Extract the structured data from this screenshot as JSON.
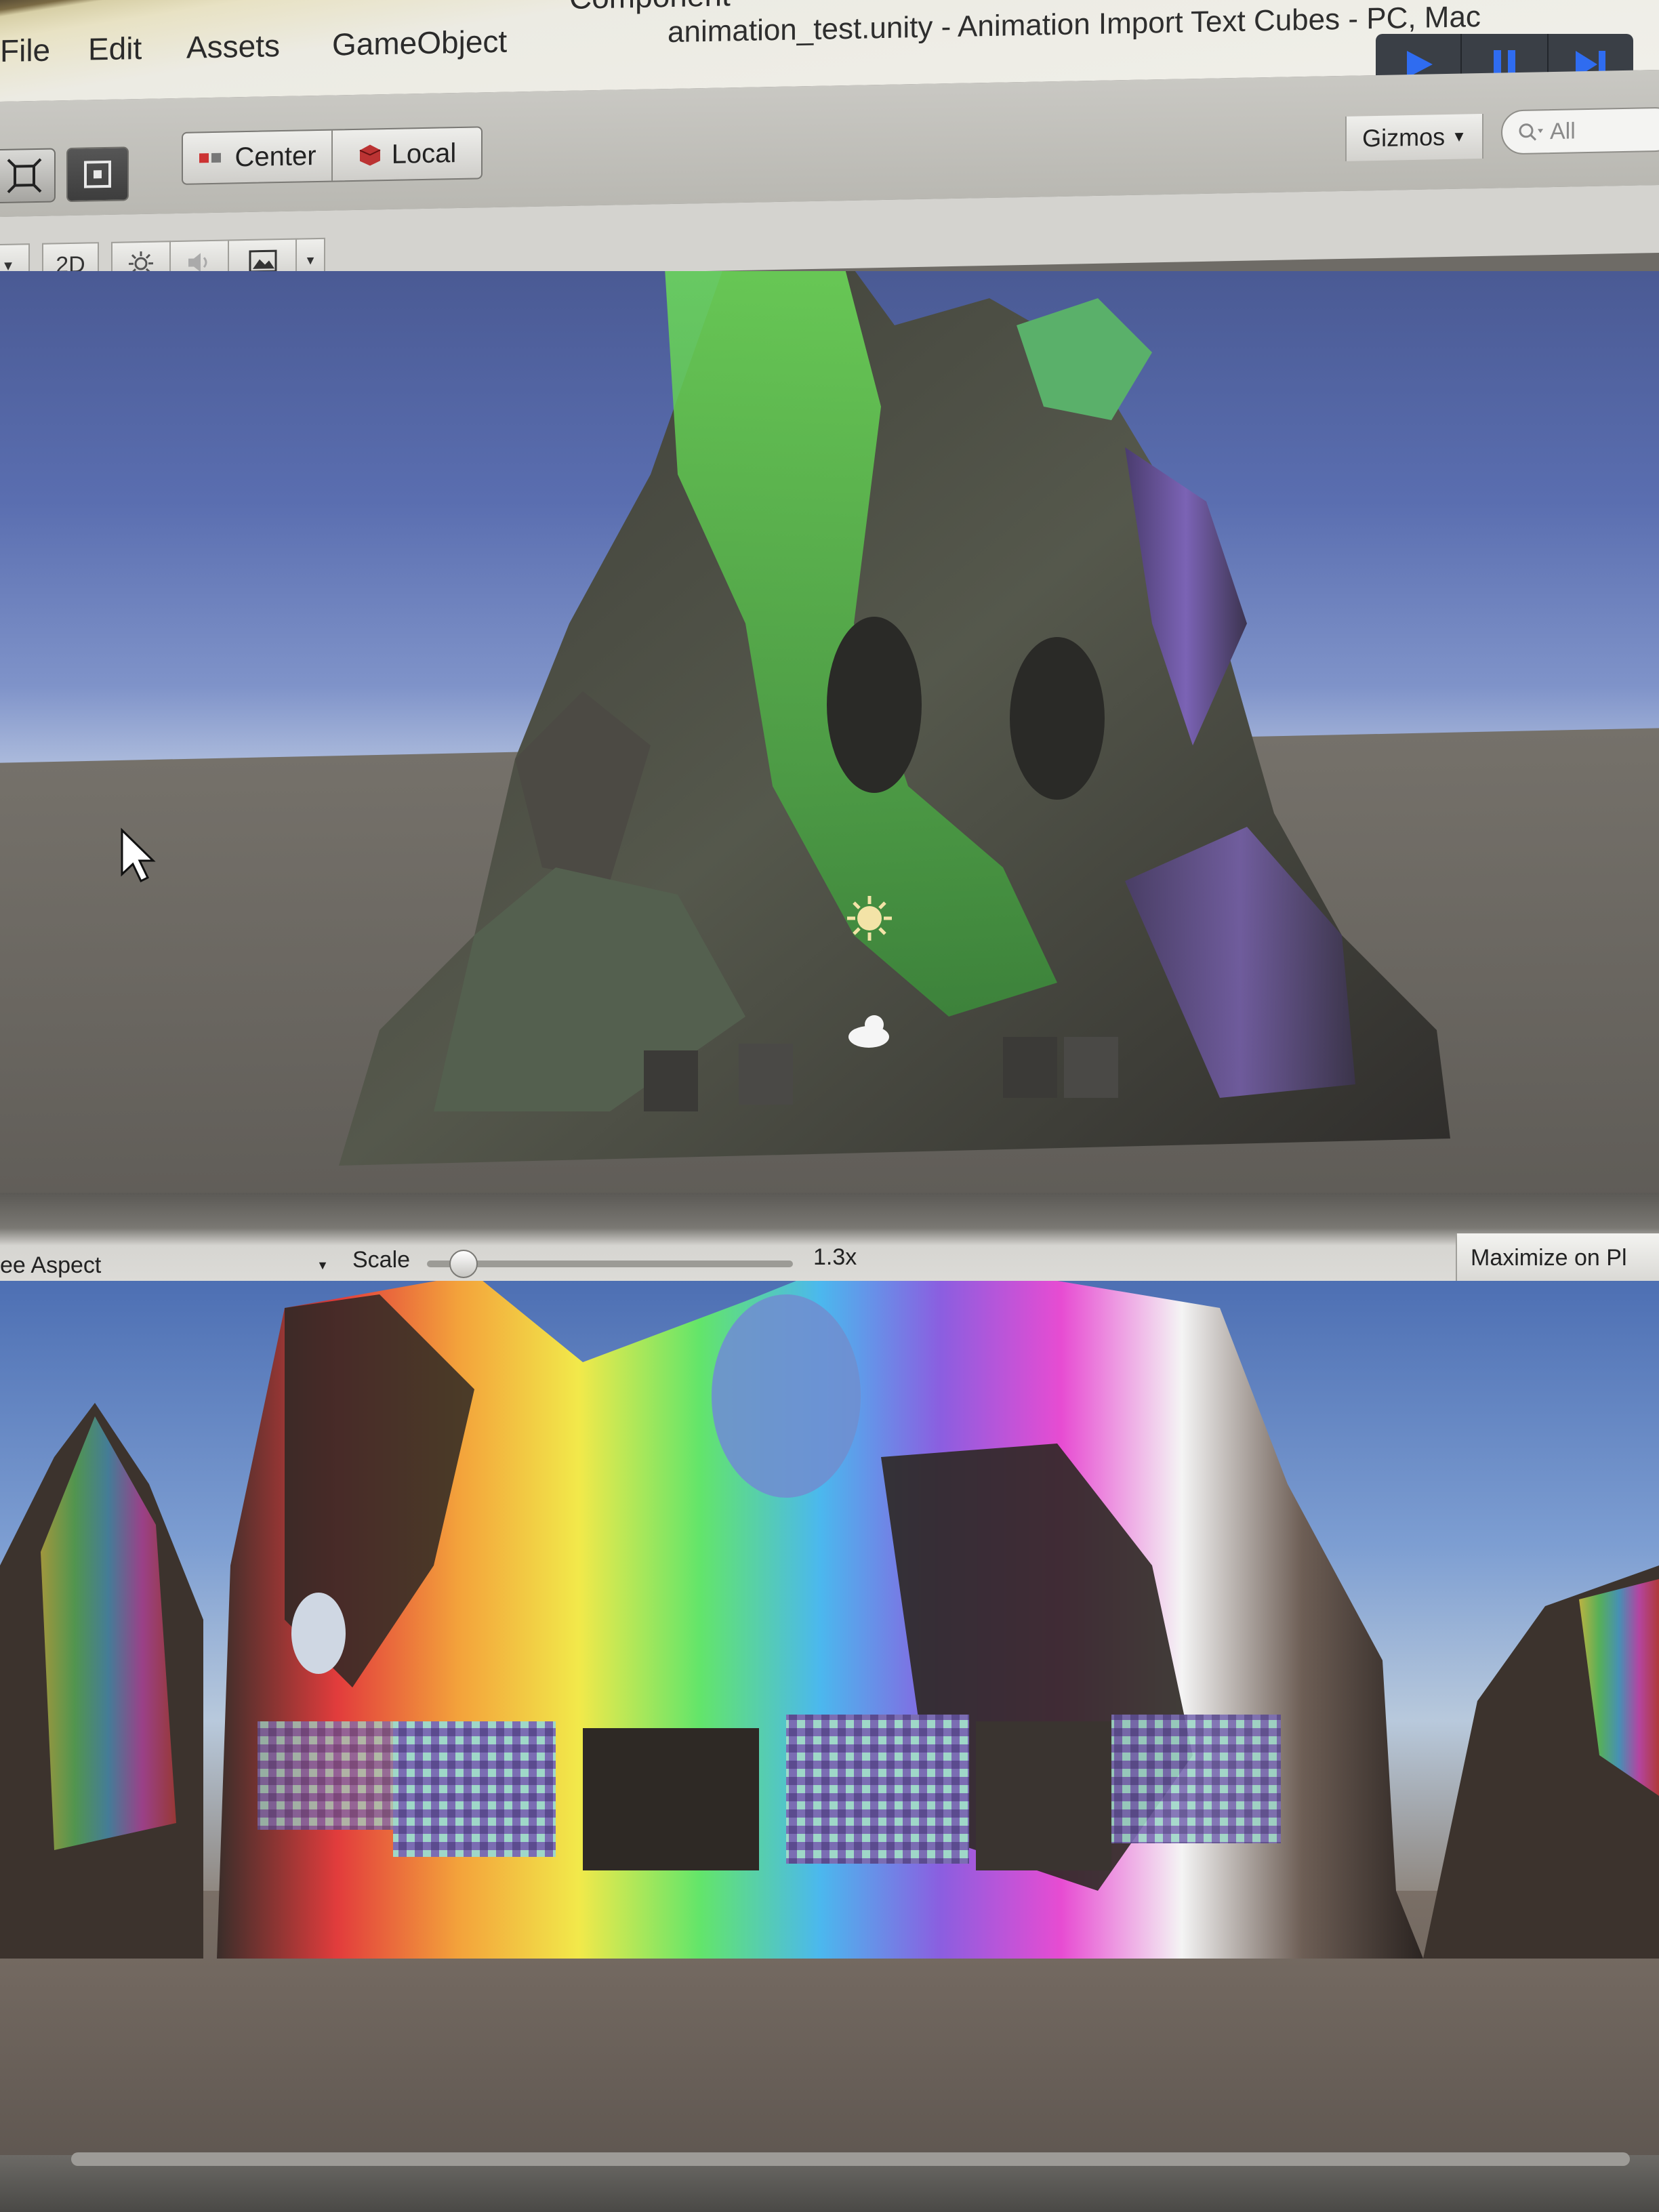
{
  "menu": {
    "items": [
      "File",
      "Edit",
      "Assets",
      "GameObject",
      "Component"
    ],
    "window_title": "animation_test.unity - Animation Import Text Cubes - PC, Mac"
  },
  "playback": {
    "play_icon": "play-icon",
    "pause_icon": "pause-icon",
    "step_icon": "step-icon",
    "accent": "#2f6cf0"
  },
  "toolbar": {
    "pivot_center_label": "Center",
    "pivot_local_label": "Local",
    "gizmos_label": "Gizmos",
    "search_placeholder": "All"
  },
  "scene_header": {
    "mode_2d_label": "2D"
  },
  "game_header": {
    "aspect_label": "ee Aspect",
    "scale_label": "Scale",
    "scale_value": "1.3x",
    "scale_level": 0.1,
    "maximize_label": "Maximize on Pl"
  }
}
